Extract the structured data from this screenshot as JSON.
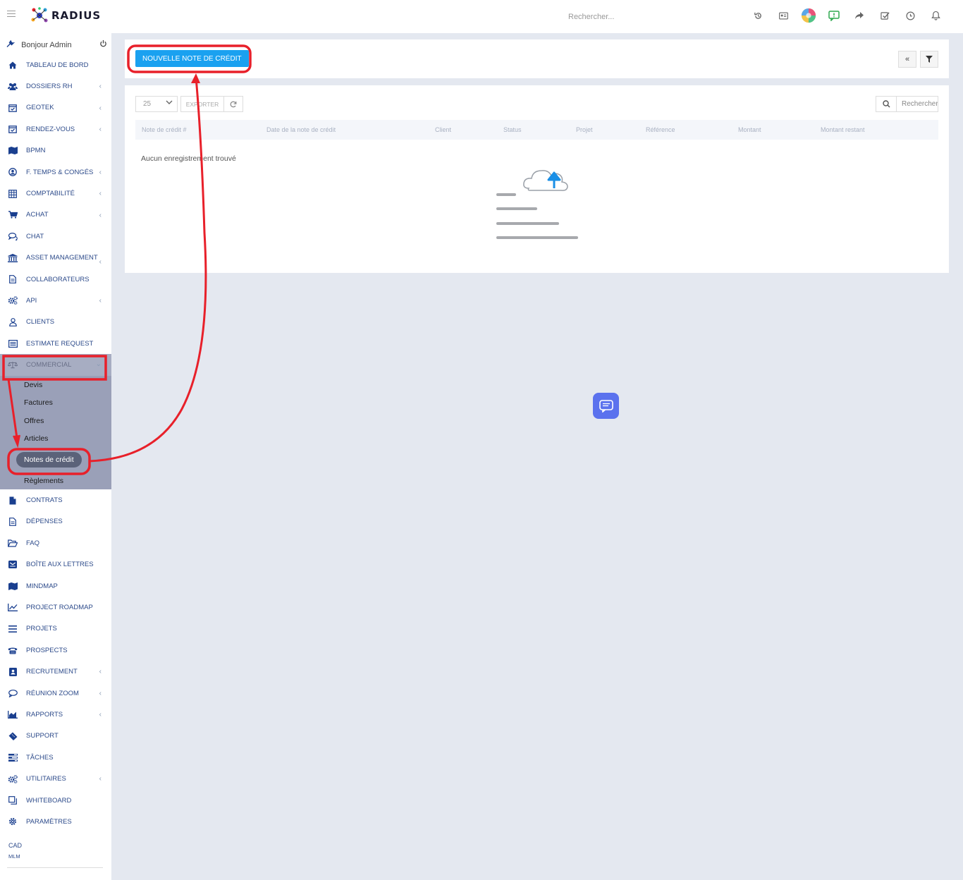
{
  "topbar": {
    "brand": "RADIUS",
    "search_placeholder": "Rechercher..."
  },
  "sidebar": {
    "greeting": "Bonjour Admin",
    "items": [
      {
        "label": "TABLEAU DE BORD",
        "icon": "home-icon",
        "chevron": false
      },
      {
        "label": "DOSSIERS RH",
        "icon": "users-icon",
        "chevron": true
      },
      {
        "label": "GEOTEK",
        "icon": "calendar-check-icon",
        "chevron": true
      },
      {
        "label": "RENDEZ-VOUS",
        "icon": "calendar-check-icon",
        "chevron": true
      },
      {
        "label": "BPMN",
        "icon": "map-icon",
        "chevron": false
      },
      {
        "label": "F. TEMPS & CONGÉS",
        "icon": "user-circle-icon",
        "chevron": true
      },
      {
        "label": "COMPTABILITÉ",
        "icon": "table-icon",
        "chevron": true
      },
      {
        "label": "ACHAT",
        "icon": "cart-icon",
        "chevron": true
      },
      {
        "label": "CHAT",
        "icon": "chat-icon",
        "chevron": false
      },
      {
        "label": "ASSET MANAGEMENT",
        "icon": "bank-icon",
        "chevron": true
      },
      {
        "label": "COLLABORATEURS",
        "icon": "document-icon",
        "chevron": false
      },
      {
        "label": "API",
        "icon": "gears-icon",
        "chevron": true
      },
      {
        "label": "CLIENTS",
        "icon": "user-icon",
        "chevron": false
      },
      {
        "label": "ESTIMATE REQUEST",
        "icon": "list-icon",
        "chevron": false
      }
    ],
    "commercial": {
      "label": "COMMERCIAL",
      "icon": "scale-icon",
      "subitems": [
        "Devis",
        "Factures",
        "Offres",
        "Articles",
        "Notes de crédit",
        "Règlements"
      ],
      "active": "Notes de crédit"
    },
    "items2": [
      {
        "label": "CONTRATS",
        "icon": "file-icon",
        "chevron": false
      },
      {
        "label": "DÉPENSES",
        "icon": "document-icon",
        "chevron": false
      },
      {
        "label": "FAQ",
        "icon": "folder-open-icon",
        "chevron": false
      },
      {
        "label": "BOÎTE AUX LETTRES",
        "icon": "mail-icon",
        "chevron": false
      },
      {
        "label": "MINDMAP",
        "icon": "map-icon",
        "chevron": false
      },
      {
        "label": "PROJECT ROADMAP",
        "icon": "line-chart-icon",
        "chevron": false
      },
      {
        "label": "PROJETS",
        "icon": "bars-icon",
        "chevron": false
      },
      {
        "label": "PROSPECTS",
        "icon": "phone-icon",
        "chevron": false
      },
      {
        "label": "RECRUTEMENT",
        "icon": "badge-icon",
        "chevron": true
      },
      {
        "label": "RÉUNION ZOOM",
        "icon": "comment-icon",
        "chevron": true
      },
      {
        "label": "RAPPORTS",
        "icon": "area-chart-icon",
        "chevron": true
      },
      {
        "label": "SUPPORT",
        "icon": "ticket-icon",
        "chevron": false
      },
      {
        "label": "TÂCHES",
        "icon": "tasks-icon",
        "chevron": false
      },
      {
        "label": "UTILITAIRES",
        "icon": "gears-icon",
        "chevron": true
      },
      {
        "label": "WHITEBOARD",
        "icon": "clone-icon",
        "chevron": false
      },
      {
        "label": "PARAMÈTRES",
        "icon": "gear-icon",
        "chevron": false
      }
    ],
    "footer_cad": "CAD",
    "footer_mlm": "MLM"
  },
  "main": {
    "new_button": "NOUVELLE NOTE DE CRÉDIT",
    "page_size": "25",
    "export_label": "EXPORTER",
    "search_placeholder": "Rechercher",
    "columns": [
      "Note de crédit #",
      "Date de la note de crédit",
      "Client",
      "Status",
      "Projet",
      "Référence",
      "Montant",
      "Montant restant"
    ],
    "empty_message": "Aucun enregistrement trouvé"
  },
  "colors": {
    "accent": "#1aa1f0",
    "sidebar_text": "#2c4a8a",
    "annotation": "#e8202a",
    "chat_fab": "#5b72ee"
  }
}
